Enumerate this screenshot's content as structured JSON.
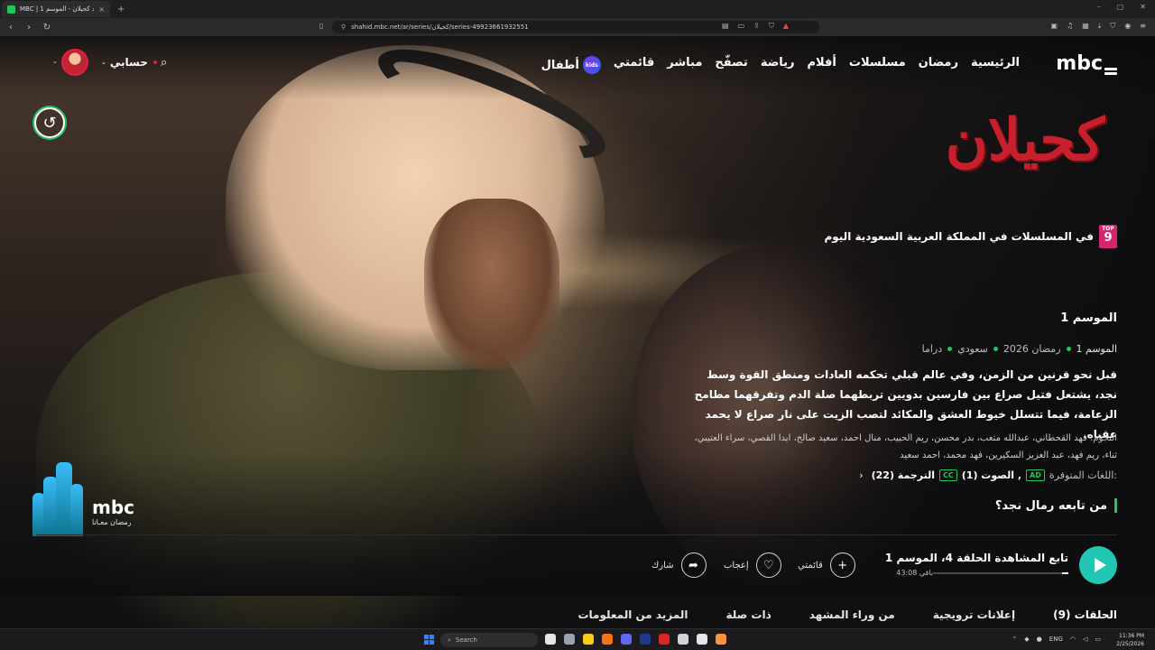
{
  "browser": {
    "tab_title": "MBC | شاهد كحيلان - الموسم 1 ...",
    "tab_close": "×",
    "new_tab": "+",
    "url": "shahid.mbc.net/ar/series/كحيلان/series-49923661932551"
  },
  "nav": {
    "logo": "mbc",
    "items": [
      "الرئيسية",
      "رمضان",
      "مسلسلات",
      "أفلام",
      "رياضة",
      "تصفّح",
      "مباشر",
      "قائمتي",
      "أطفال"
    ],
    "kids_badge": "kids",
    "account": "حسابي"
  },
  "show": {
    "title_art": "كحيلان",
    "top_label": "TOP",
    "rank": "9",
    "rank_text": "في المسلسلات في المملكة العربية السعودية اليوم",
    "season_title": "الموسم 1",
    "meta": [
      "الموسم 1",
      "رمضان 2026",
      "سعودي",
      "دراما"
    ],
    "synopsis": "قبل نحو قرنين من الزمن، وفي عالم قبلي تحكمه العادات ومنطق القوة وسط نجد، يشتعل فتيل صراع بين فارسين بدويين تربطهما صلة الدم وتفرقهما مطامح الزعامة، فيما تتسلل خيوط العشق والمكائد لتصب الزيت على نار صراع لا يحمد عقباه.",
    "cast_label": "النجوم:",
    "cast": "فهد القحطاني، عبدالله متعب، بدر محسن، ريم الحبيب، منال احمد، سعيد صالح، ايدا القصي، سراء العتيبي، ثناء، ريم فهد، عبد العزيز السكيرين، فهد محمد، احمد سعيد",
    "langs_label": "اللغات المتوفرة:",
    "audio_badge": "AD",
    "audio": "الصوت (1) ,",
    "subs_badge": "CC",
    "subs": "الترجمة (22)",
    "question": "من تابعه رمال نجد؟"
  },
  "ramadan_logo": {
    "brand": "mbc",
    "sub": "رمضان معـانا"
  },
  "player": {
    "continue": "تابع المشاهدة الحلقة 4، الموسم 1",
    "remaining": "43:08 باقي",
    "progress": 0.05,
    "add_label": "قائمتي",
    "like_label": "إعجاب",
    "share_label": "شارك"
  },
  "tabs": [
    "الحلقات (9)",
    "إعلانات ترويجية",
    "من وراء المشهد",
    "ذات صلة",
    "المزيد من المعلومات"
  ],
  "taskbar": {
    "search": "Search",
    "lang": "ENG",
    "time": "11:36 PM",
    "date": "2/25/2026"
  },
  "colors": {
    "accent": "#22c55e",
    "play": "#22c7b3",
    "rank": "#d6246e",
    "title": "#c81f2c"
  }
}
